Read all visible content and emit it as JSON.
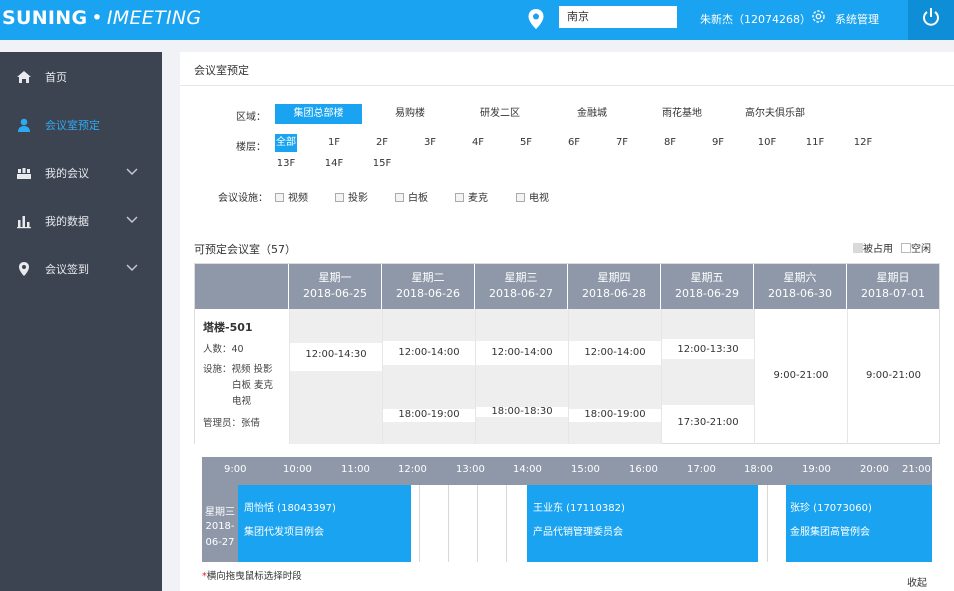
{
  "header": {
    "logo_brand": "SUNING",
    "logo_dot": "•",
    "logo_product": "IMEETING",
    "city": "南京",
    "user": "朱新杰（12074268）",
    "system_label": "系统管理"
  },
  "sidebar": {
    "items": [
      {
        "label": "首页",
        "icon": "home-icon"
      },
      {
        "label": "会议室预定",
        "icon": "user-icon",
        "active": true
      },
      {
        "label": "我的会议",
        "icon": "meeting-icon",
        "expandable": true
      },
      {
        "label": "我的数据",
        "icon": "bar-chart-icon",
        "expandable": true
      },
      {
        "label": "会议签到",
        "icon": "location-icon",
        "expandable": true
      }
    ]
  },
  "page": {
    "title": "会议室预定"
  },
  "filters": {
    "area_label": "区域：",
    "areas": [
      "集团总部楼",
      "易购楼",
      "研发二区",
      "金融城",
      "雨花基地",
      "高尔夫俱乐部"
    ],
    "selected_area": "集团总部楼",
    "floor_label": "楼层：",
    "floors": [
      "全部",
      "1F",
      "2F",
      "3F",
      "4F",
      "5F",
      "6F",
      "7F",
      "8F",
      "9F",
      "10F",
      "11F",
      "12F",
      "13F",
      "14F",
      "15F"
    ],
    "selected_floor": "全部",
    "facility_label": "会议设施：",
    "facilities": [
      "视频",
      "投影",
      "白板",
      "麦克",
      "电视"
    ]
  },
  "results": {
    "title": "可预定会议室（57）",
    "legend_occupied": "被占用",
    "legend_free": "空闲"
  },
  "calendar": {
    "days": [
      {
        "weekday": "星期一",
        "date": "2018-06-25"
      },
      {
        "weekday": "星期二",
        "date": "2018-06-26"
      },
      {
        "weekday": "星期三",
        "date": "2018-06-27"
      },
      {
        "weekday": "星期四",
        "date": "2018-06-28"
      },
      {
        "weekday": "星期五",
        "date": "2018-06-29"
      },
      {
        "weekday": "星期六",
        "date": "2018-06-30"
      },
      {
        "weekday": "星期日",
        "date": "2018-07-01"
      }
    ],
    "room": {
      "name": "塔楼-501",
      "capacity": "人数：40",
      "facilities_line1": "设施：视频 投影",
      "facilities_line2": "白板 麦克",
      "facilities_line3": "电视",
      "admin": "管理员：张倩"
    },
    "free_slots": [
      [
        "12:00-14:30"
      ],
      [
        "12:00-14:00",
        "18:00-19:00"
      ],
      [
        "12:00-14:00",
        "18:00-18:30"
      ],
      [
        "12:00-14:00",
        "18:00-19:00"
      ],
      [
        "12:00-13:30",
        "17:30-21:00"
      ],
      [
        "9:00-21:00"
      ],
      [
        "9:00-21:00"
      ]
    ]
  },
  "timeline": {
    "hours": [
      "9:00",
      "10:00",
      "11:00",
      "12:00",
      "13:00",
      "14:00",
      "15:00",
      "16:00",
      "17:00",
      "18:00",
      "19:00",
      "20:00",
      "21:00"
    ],
    "day_weekday": "星期三",
    "day_date_line1": "2018-",
    "day_date_line2": "06-27",
    "bookings": [
      {
        "start": "9:00",
        "end": "12:00",
        "person": "周怡恬 (18043397)",
        "topic": "集团代发项目例会"
      },
      {
        "start": "14:00",
        "end": "18:00",
        "person": "王业东 (17110382)",
        "topic": "产品代销管理委员会"
      },
      {
        "start": "18:30",
        "end": "21:00",
        "person": "张珍 (17073060)",
        "topic": "金服集团高管例会"
      }
    ],
    "hint_mark": "*",
    "hint_text": "横向拖曳鼠标选择时段",
    "collapse_label": "收起"
  },
  "colors": {
    "brand": "#1aa3f0",
    "sidebar": "#3d4451",
    "header_gray": "#8e98a8",
    "occupied": "#eeeeee"
  }
}
